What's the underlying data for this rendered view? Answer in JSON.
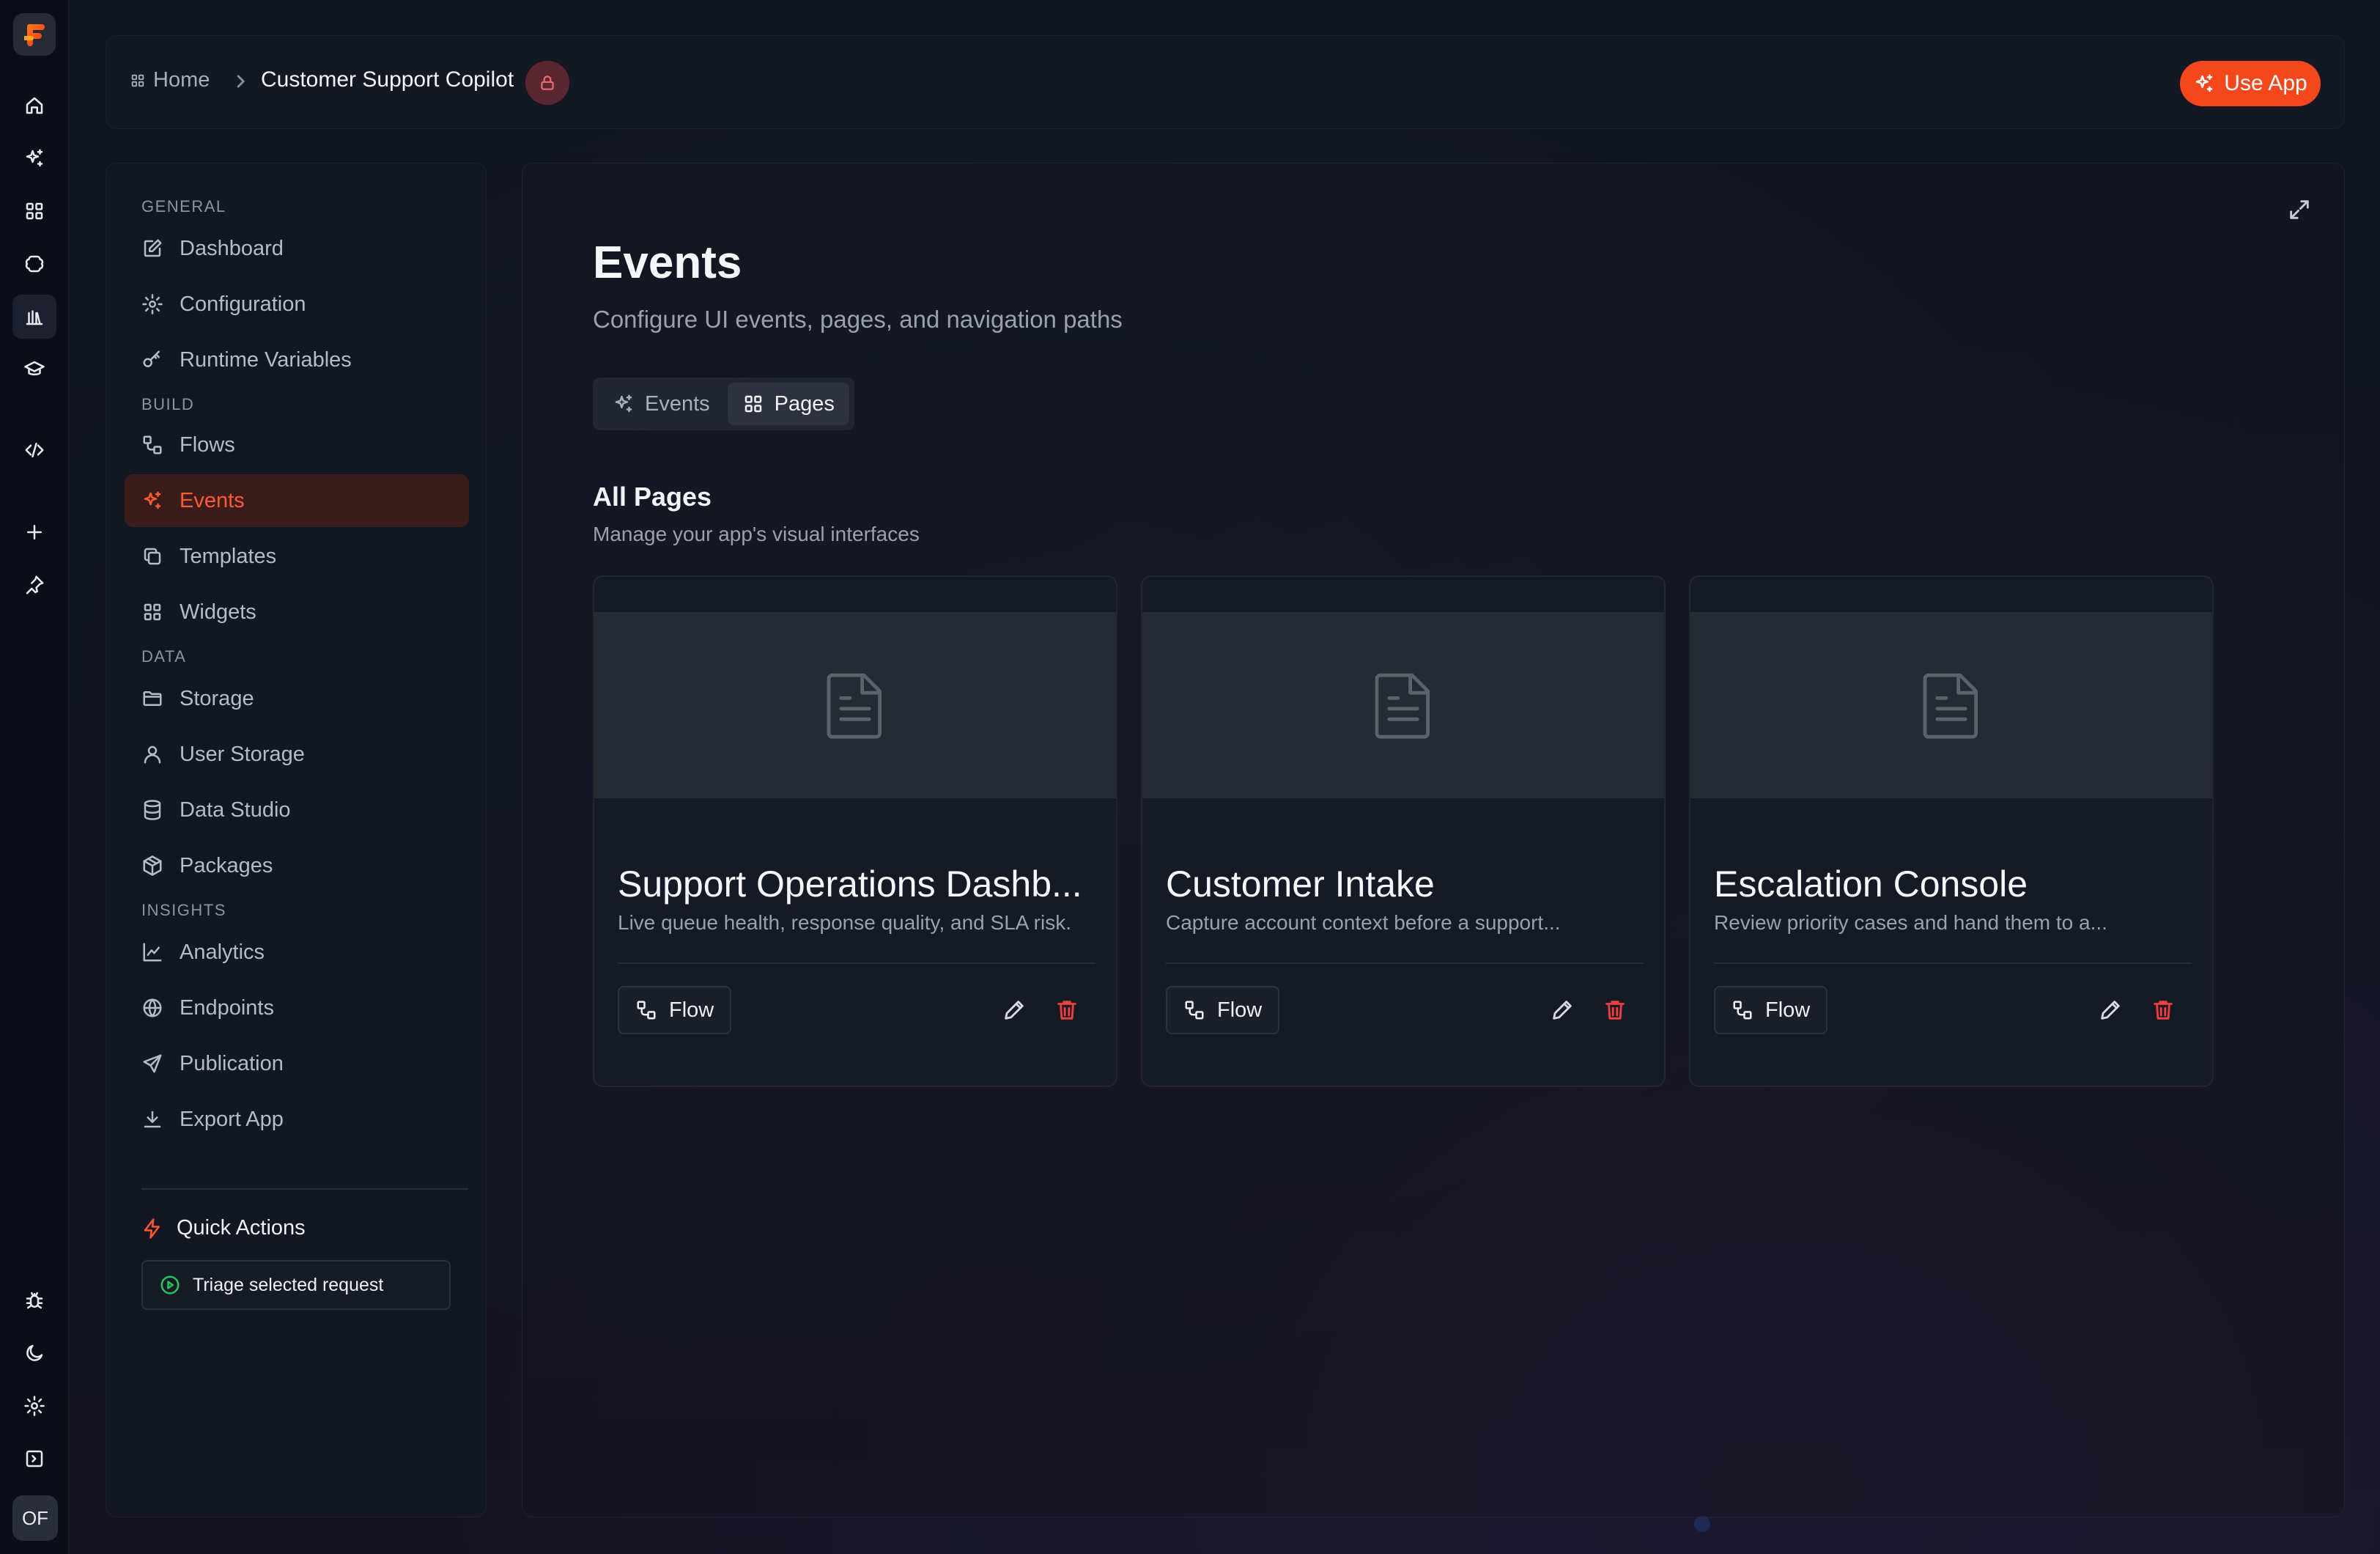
{
  "rail": {
    "items": [
      {
        "name": "home-icon"
      },
      {
        "name": "sparkles-icon"
      },
      {
        "name": "grid-icon"
      },
      {
        "name": "brain-icon"
      },
      {
        "name": "library-icon"
      },
      {
        "name": "graduation-cap-icon"
      },
      {
        "name": "code-icon"
      },
      {
        "name": "plus-icon"
      },
      {
        "name": "pin-icon"
      },
      {
        "name": "bug-icon"
      },
      {
        "name": "moon-icon"
      },
      {
        "name": "gear-icon"
      },
      {
        "name": "panel-toggle-icon"
      }
    ],
    "avatar": "OF"
  },
  "topbar": {
    "home_label": "Home",
    "current_app": "Customer Support Copilot",
    "use_app_label": "Use App"
  },
  "sidebar": {
    "sections": {
      "general": "GENERAL",
      "build": "BUILD",
      "data": "DATA",
      "insights": "INSIGHTS"
    },
    "items": {
      "dashboard": "Dashboard",
      "configuration": "Configuration",
      "runtime_variables": "Runtime Variables",
      "flows": "Flows",
      "events": "Events",
      "templates": "Templates",
      "widgets": "Widgets",
      "storage": "Storage",
      "user_storage": "User Storage",
      "data_studio": "Data Studio",
      "packages": "Packages",
      "analytics": "Analytics",
      "endpoints": "Endpoints",
      "publication": "Publication",
      "export_app": "Export App"
    },
    "active": "events",
    "quick_actions": {
      "title": "Quick Actions",
      "action": "Triage selected request"
    }
  },
  "main": {
    "title": "Events",
    "subtitle": "Configure UI events, pages, and navigation paths",
    "tabs": [
      {
        "label": "Events",
        "active": false
      },
      {
        "label": "Pages",
        "active": true
      }
    ],
    "section_title": "All Pages",
    "section_subtitle": "Manage your app's visual interfaces",
    "pages": [
      {
        "title": "Support Operations Dashb...",
        "description": "Live queue health, response quality, and SLA risk.",
        "flow_label": "Flow"
      },
      {
        "title": "Customer Intake",
        "description": "Capture account context before a support...",
        "flow_label": "Flow"
      },
      {
        "title": "Escalation Console",
        "description": "Review priority cases and hand them to a...",
        "flow_label": "Flow"
      }
    ]
  },
  "colors": {
    "accent": "#f4481c",
    "active_nav_bg": "#3a1d1b",
    "danger": "#ef3f3f",
    "success": "#22c55e"
  }
}
